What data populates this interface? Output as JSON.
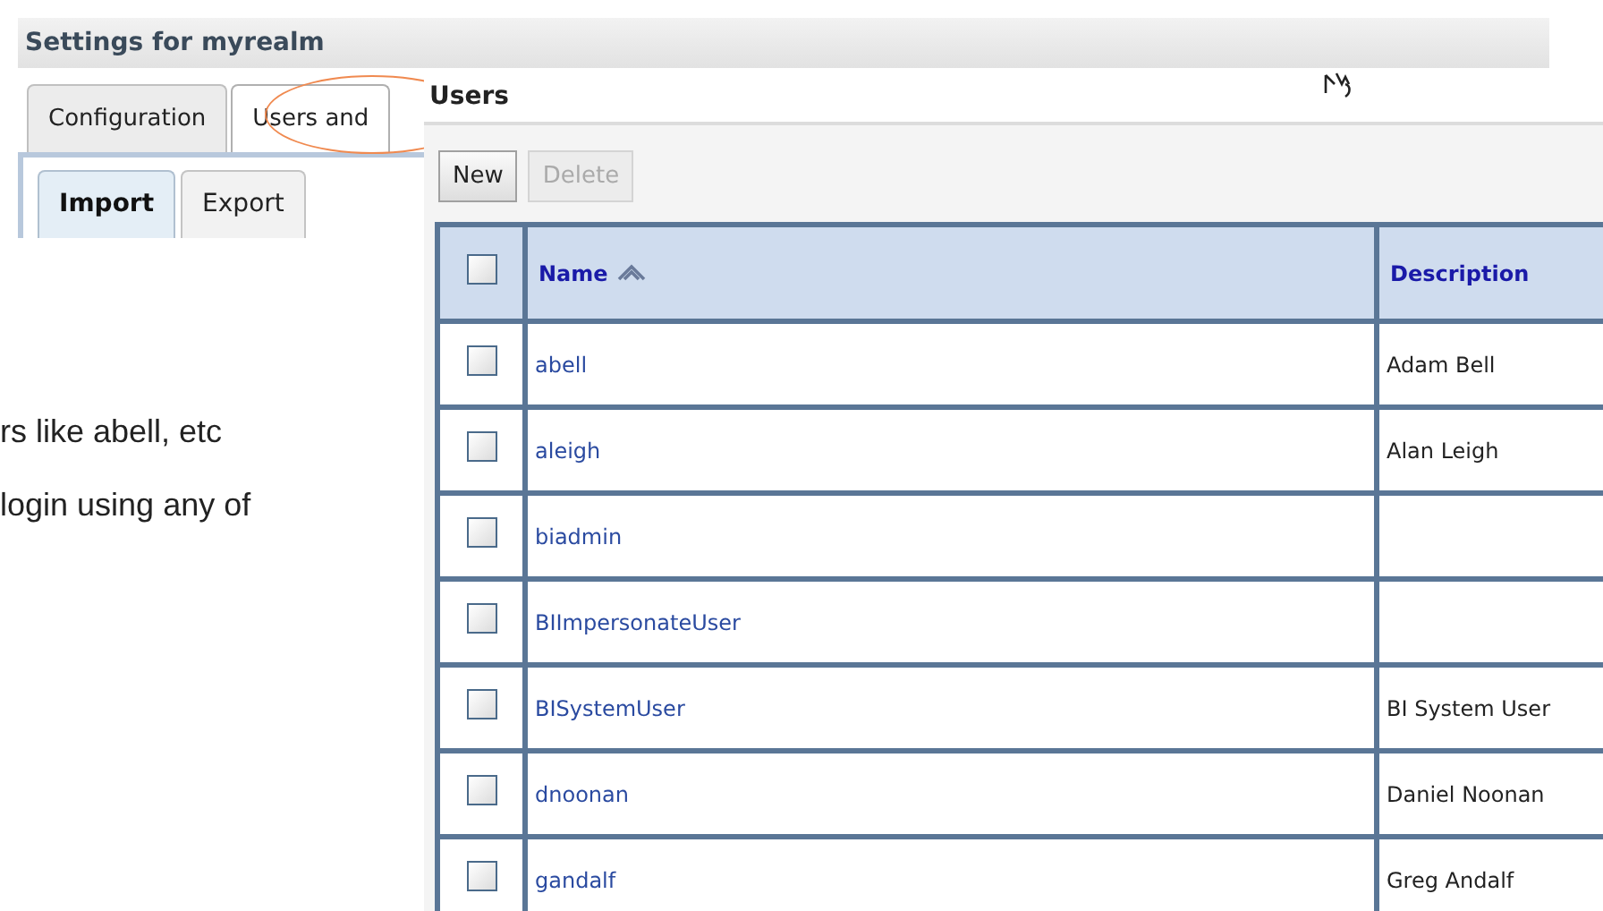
{
  "settings": {
    "title": "Settings for myrealm",
    "tabs": [
      {
        "label": "Configuration",
        "selected": false
      },
      {
        "label": "Users and",
        "selected": true
      }
    ],
    "subtabs": [
      {
        "label": "Import",
        "selected": true
      },
      {
        "label": "Export",
        "selected": false
      }
    ],
    "text_lines": [
      "rs like abell, etc",
      "login using any of"
    ]
  },
  "users_panel": {
    "title": "Users",
    "buttons": [
      {
        "label": "New",
        "disabled": false
      },
      {
        "label": "Delete",
        "disabled": true
      }
    ],
    "table": {
      "select_all_checked": false,
      "columns": [
        "Name",
        "Description"
      ],
      "rows": [
        {
          "checked": false,
          "name": "abell",
          "description": "Adam Bell"
        },
        {
          "checked": false,
          "name": "aleigh",
          "description": "Alan Leigh"
        },
        {
          "checked": false,
          "name": "biadmin",
          "description": ""
        },
        {
          "checked": false,
          "name": "BIImpersonateUser",
          "description": ""
        },
        {
          "checked": false,
          "name": "BISystemUser",
          "description": "BI System User"
        },
        {
          "checked": false,
          "name": "dnoonan",
          "description": "Daniel Noonan"
        },
        {
          "checked": false,
          "name": "gandalf",
          "description": "Greg Andalf"
        }
      ]
    }
  }
}
